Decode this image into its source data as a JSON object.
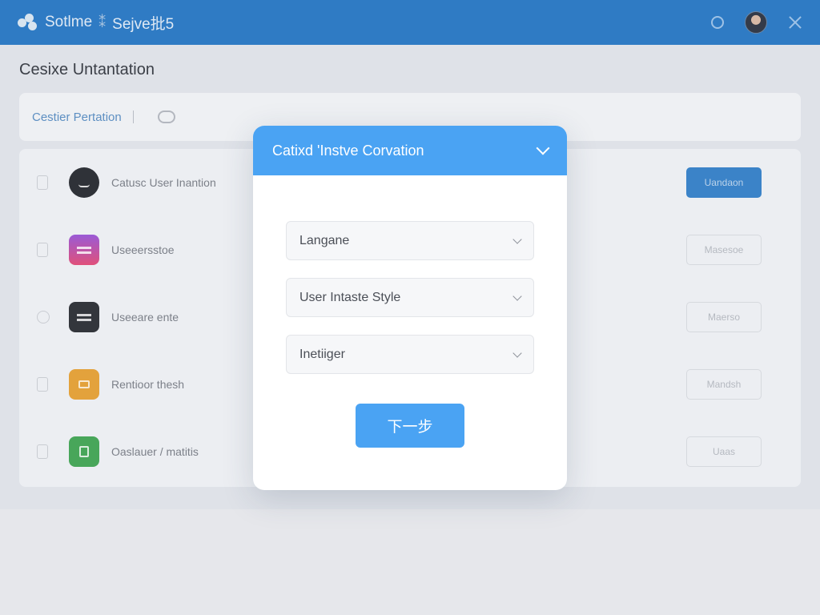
{
  "topbar": {
    "brand": "Sotlme",
    "subtitle": "Sejve批5"
  },
  "page": {
    "title": "Cesixe Untantation",
    "active_tab": "Cestier Pertation"
  },
  "rows": [
    {
      "label": "Catusc User Inantion",
      "button": "Uandaon",
      "icon": "face-icon",
      "color": "#2f3238",
      "primary": true
    },
    {
      "label": "Useeersstoe",
      "button": "Masesoe",
      "icon": "layers-icon",
      "color": "#8b5bd0",
      "primary": false
    },
    {
      "label": "Useeare ente",
      "button": "Maerso",
      "icon": "menu-icon",
      "color": "#33363c",
      "primary": false
    },
    {
      "label": "Rentioor thesh",
      "button": "Mandsh",
      "icon": "note-icon",
      "color": "#e3a23c",
      "primary": false
    },
    {
      "label": "Oaslauer / matitis",
      "button": "Uaas",
      "icon": "doc-icon",
      "color": "#48a65a",
      "primary": false
    }
  ],
  "modal": {
    "title": "Catixd 'Instve Corvation",
    "fields": [
      {
        "label": "Langane"
      },
      {
        "label": "User Intaste Style"
      },
      {
        "label": "Inetiiger"
      }
    ],
    "next_button": "下一步"
  }
}
